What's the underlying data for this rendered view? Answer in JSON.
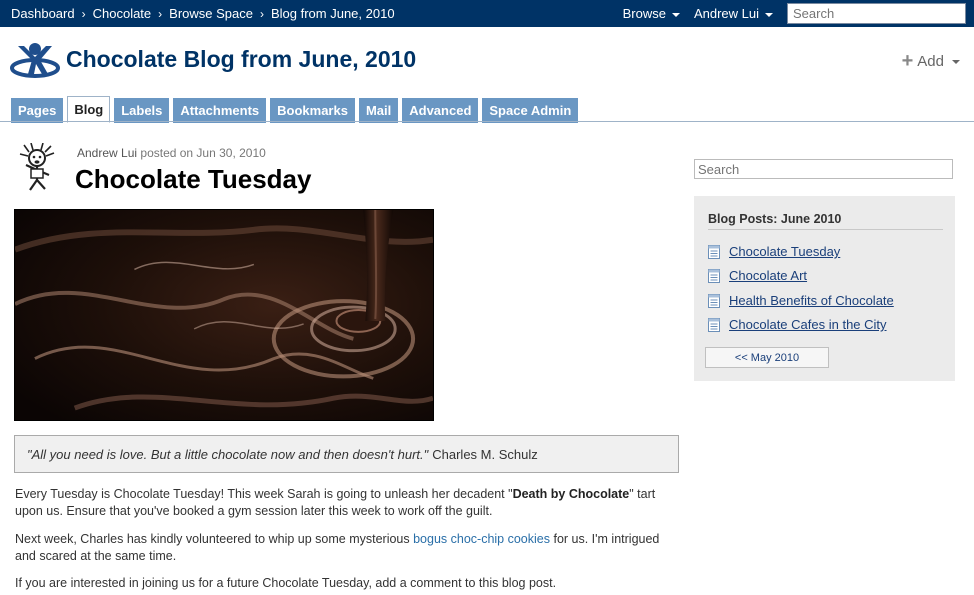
{
  "topbar": {
    "breadcrumbs": [
      "Dashboard",
      "Chocolate",
      "Browse Space",
      "Blog from June, 2010"
    ],
    "separator": "›",
    "browse_label": "Browse",
    "user_label": "Andrew Lui",
    "search_placeholder": "Search"
  },
  "header": {
    "space_title": "Chocolate Blog from June, 2010",
    "add_label": "Add",
    "add_icon": "plus-icon"
  },
  "tabs": [
    {
      "label": "Pages",
      "active": false
    },
    {
      "label": "Blog",
      "active": true
    },
    {
      "label": "Labels",
      "active": false
    },
    {
      "label": "Attachments",
      "active": false
    },
    {
      "label": "Bookmarks",
      "active": false
    },
    {
      "label": "Mail",
      "active": false
    },
    {
      "label": "Advanced",
      "active": false
    },
    {
      "label": "Space Admin",
      "active": false
    }
  ],
  "post": {
    "author": "Andrew Lui",
    "posted_on": "posted on Jun 30, 2010",
    "title": "Chocolate Tuesday",
    "quote_text": "\"All you need is love. But a little chocolate now and then doesn't hurt.\"",
    "quote_author": "Charles M. Schulz",
    "para1_a": "Every Tuesday is Chocolate Tuesday! This week Sarah is going to unleash her decadent \"",
    "para1_bold": "Death by Chocolate",
    "para1_b": "\" tart upon us. Ensure that you've booked a gym session later this week to work off the guilt.",
    "para2_a": "Next week, Charles has kindly volunteered to whip up some mysterious ",
    "para2_link": "bogus choc-chip cookies",
    "para2_b": " for us. I'm intrigued and scared at the same time.",
    "para3": "If you are interested in joining us for a future Chocolate Tuesday, add a comment to this blog post."
  },
  "sidebar": {
    "search_placeholder": "Search",
    "heading": "Blog Posts: June 2010",
    "items": [
      {
        "label": "Chocolate Tuesday"
      },
      {
        "label": "Chocolate Art"
      },
      {
        "label": "Health Benefits of Chocolate"
      },
      {
        "label": "Chocolate Cafes in the City"
      }
    ],
    "prev_label": "<< May 2010"
  },
  "colors": {
    "topbar": "#003366",
    "tab": "#6a97c3",
    "title": "#003366",
    "link": "#1a3f7a"
  }
}
